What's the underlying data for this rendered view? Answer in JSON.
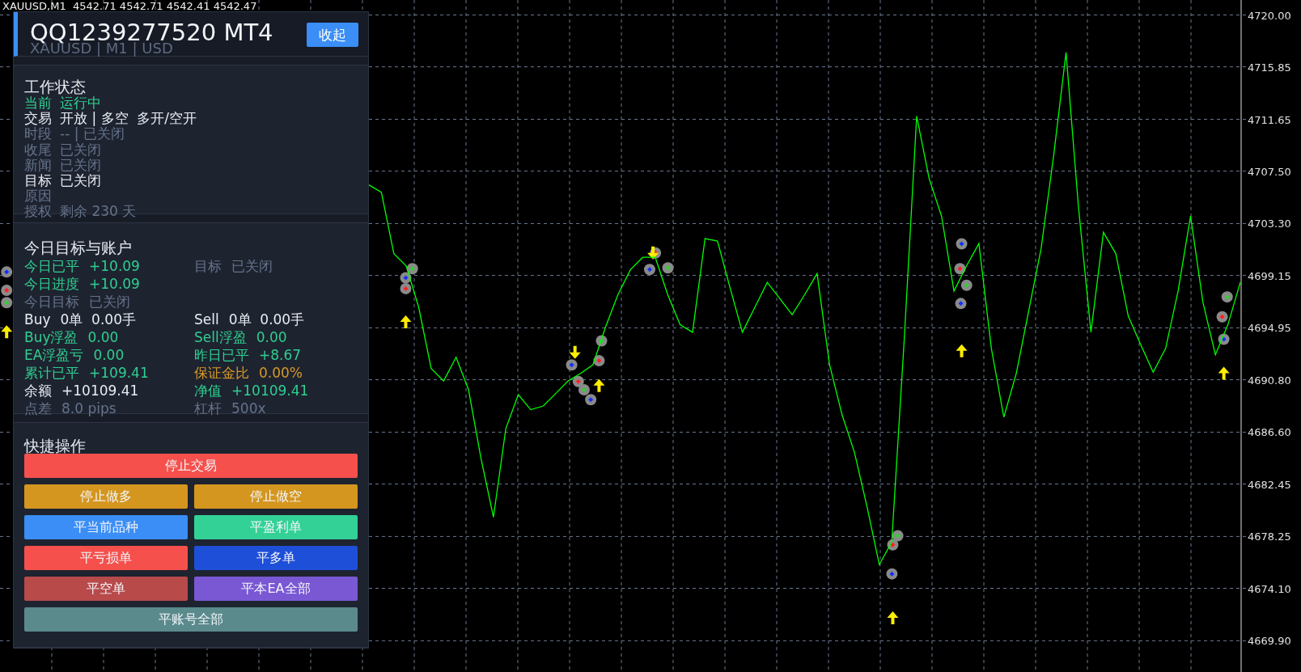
{
  "symbol_bar": {
    "text": "XAUUSD,M1  4542.71 4542.71 4542.41 4542.47"
  },
  "chart": {
    "chart_data": {
      "type": "line",
      "grid": true,
      "ylim": [
        4667.4,
        4721.2
      ],
      "yticks": [
        {
          "value": 4720.0,
          "label": "4720.00"
        },
        {
          "value": 4715.85,
          "label": "4715.85"
        },
        {
          "value": 4711.65,
          "label": "4711.65"
        },
        {
          "value": 4707.5,
          "label": "4707.50"
        },
        {
          "value": 4703.3,
          "label": "4703.30"
        },
        {
          "value": 4699.15,
          "label": "4699.15"
        },
        {
          "value": 4694.95,
          "label": "4694.95"
        },
        {
          "value": 4690.8,
          "label": "4690.80"
        },
        {
          "value": 4686.6,
          "label": "4686.60"
        },
        {
          "value": 4682.45,
          "label": "4682.45"
        },
        {
          "value": 4678.25,
          "label": "4678.25"
        },
        {
          "value": 4674.1,
          "label": "4674.10"
        },
        {
          "value": 4669.9,
          "label": "4669.90"
        }
      ],
      "series": [
        {
          "color": "#00ff00",
          "values": [
            4706.4,
            4705.8,
            4700.9,
            4699.9,
            4696.6,
            4691.7,
            4690.7,
            4692.6,
            4690.0,
            4684.5,
            4679.8,
            4686.9,
            4689.6,
            4688.4,
            4688.7,
            4689.7,
            4690.7,
            4691.3,
            4692.0,
            4695.0,
            4697.6,
            4699.6,
            4700.6,
            4700.6,
            4697.6,
            4695.2,
            4694.6,
            4702.1,
            4701.9,
            4698.2,
            4694.6,
            4696.6,
            4698.6,
            4697.3,
            4696.0,
            4697.6,
            4699.3,
            4692.0,
            4688.0,
            4685.0,
            4680.7,
            4676.0,
            4677.8,
            4694.0,
            4711.9,
            4706.9,
            4703.9,
            4697.9,
            4699.9,
            4701.7,
            4693.3,
            4687.8,
            4691.3,
            4696.3,
            4701.3,
            4708.7,
            4717.0,
            4704.6,
            4694.6,
            4702.6,
            4700.9,
            4695.9,
            4693.6,
            4691.4,
            4693.3,
            4697.9,
            4703.9,
            4697.0,
            4692.8,
            4695.2,
            4698.6
          ]
        }
      ]
    }
  },
  "panel": {
    "title": "QQ1239277520 MT4",
    "subtitle": "XAUUSD | M1 | USD",
    "collapse_button": "收起",
    "status": {
      "title": "工作状态",
      "rows": [
        {
          "label": "当前",
          "value": "运行中",
          "kind": "good"
        },
        {
          "label": "交易",
          "value": "开放 | 多空  多开/空开",
          "kind": "normal"
        },
        {
          "label": "时段",
          "value": "-- | 已关闭",
          "kind": "muted"
        },
        {
          "label": "收尾",
          "value": "已关闭",
          "kind": "muted"
        },
        {
          "label": "新闻",
          "value": "已关闭",
          "kind": "muted"
        },
        {
          "label": "目标",
          "value": "已关闭",
          "kind": "normal"
        },
        {
          "label": "原因",
          "kind": "muted"
        },
        {
          "label": "授权",
          "value": "剩余 230 天",
          "kind": "muted"
        }
      ]
    },
    "account": {
      "title": "今日目标与账户",
      "rows": [
        {
          "cells": [
            {
              "label": "今日已平",
              "value": "+10.09",
              "kind": "good"
            },
            {
              "label": "目标",
              "value": "已关闭",
              "kind": "muted"
            }
          ]
        },
        {
          "cells": [
            {
              "label": "今日进度",
              "value": "+10.09",
              "kind": "good"
            }
          ]
        },
        {
          "cells": [
            {
              "label": "今日目标",
              "value": "已关闭",
              "kind": "muted"
            }
          ]
        },
        {
          "cells": [
            {
              "label": "Buy",
              "value": "0单  0.00手",
              "kind": "normal"
            },
            {
              "label": "Sell",
              "value": "0单  0.00手",
              "kind": "normal"
            }
          ]
        },
        {
          "cells": [
            {
              "label": "Buy浮盈",
              "value": "0.00",
              "kind": "good"
            },
            {
              "label": "Sell浮盈",
              "value": "0.00",
              "kind": "good"
            }
          ]
        },
        {
          "cells": [
            {
              "label": "EA浮盈亏",
              "value": "0.00",
              "kind": "good"
            },
            {
              "label": "昨日已平",
              "value": "+8.67",
              "kind": "good"
            }
          ]
        },
        {
          "cells": [
            {
              "label": "累计已平",
              "value": "+109.41",
              "kind": "good"
            },
            {
              "label": "保证金比",
              "value": "0.00%",
              "kind": "warn"
            }
          ]
        },
        {
          "cells": [
            {
              "label": "余额",
              "value": "+10109.41",
              "kind": "normal"
            },
            {
              "label": "净值",
              "value": "+10109.41",
              "kind": "good"
            }
          ]
        },
        {
          "cells": [
            {
              "label": "点差",
              "value": "8.0 pips",
              "kind": "muted"
            },
            {
              "label": "杠杆",
              "value": "500x",
              "kind": "muted"
            }
          ]
        }
      ]
    },
    "actions": {
      "title": "快捷操作",
      "buttons": [
        {
          "label": "停止交易",
          "color": "#f5504c",
          "kind": "wide"
        },
        {
          "label": "停止做多",
          "color": "#d4961f",
          "kind": "half"
        },
        {
          "label": "停止做空",
          "color": "#d4961f",
          "kind": "half"
        },
        {
          "label": "平当前品种",
          "color": "#3a8ef5",
          "kind": "half"
        },
        {
          "label": "平盈利单",
          "color": "#33d196",
          "kind": "half"
        },
        {
          "label": "平亏损单",
          "color": "#f5504c",
          "kind": "half"
        },
        {
          "label": "平多单",
          "color": "#1e4fd8",
          "kind": "half"
        },
        {
          "label": "平空单",
          "color": "#b84a4a",
          "kind": "half"
        },
        {
          "label": "平本EA全部",
          "color": "#7a58d4",
          "kind": "half"
        },
        {
          "label": "平账号全部",
          "color": "#5a8a8c",
          "kind": "wide"
        }
      ]
    }
  }
}
